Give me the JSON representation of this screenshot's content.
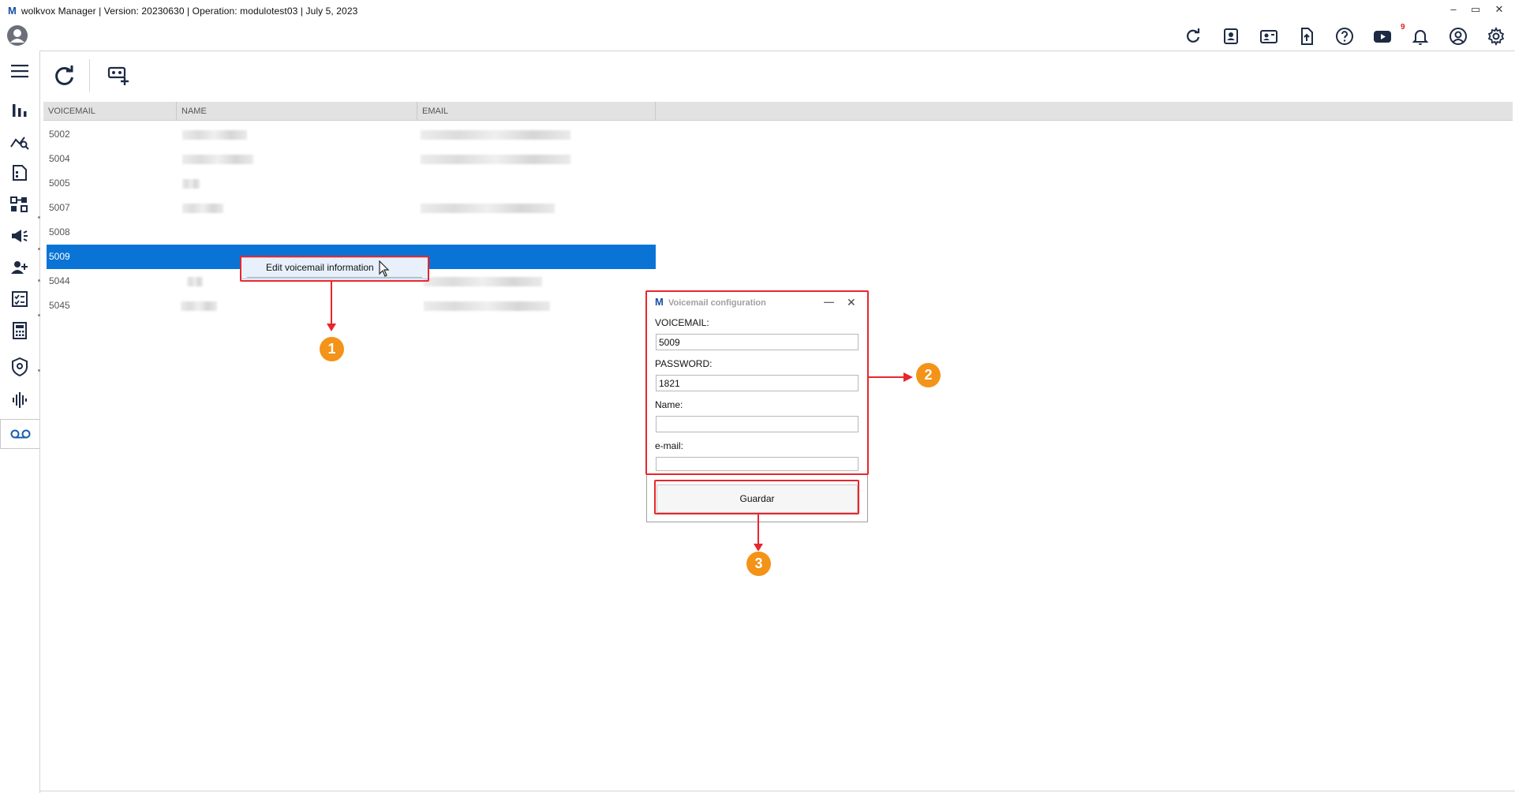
{
  "window": {
    "logo": "M",
    "title": "wolkvox Manager  | Version: 20230630 |  Operation: modulotest03 | July 5, 2023",
    "minimize": "–",
    "restore": "▭",
    "close": "✕"
  },
  "header": {
    "icons": [
      "refresh-icon",
      "contacts-book-icon",
      "id-card-icon",
      "upload-file-icon",
      "help-icon",
      "youtube-icon",
      "bell-icon",
      "user-circle-icon",
      "gear-icon"
    ],
    "notification_count": "9"
  },
  "nav": {
    "items": [
      "menu-icon",
      "bar-chart-icon",
      "analytics-icon",
      "report-icon",
      "flow-icon",
      "campaign-icon",
      "agents-icon",
      "checklist-icon",
      "calculator-icon",
      "security-icon",
      "audio-icon",
      "voicemail-icon"
    ],
    "active": "voicemail-icon"
  },
  "toolbar": {
    "buttons": [
      "refresh-icon",
      "add-voicemail-icon"
    ]
  },
  "grid": {
    "columns": [
      "VOICEMAIL",
      "NAME",
      "EMAIL"
    ],
    "rows": [
      {
        "voicemail": "5002"
      },
      {
        "voicemail": "5004"
      },
      {
        "voicemail": "5005"
      },
      {
        "voicemail": "5007"
      },
      {
        "voicemail": "5008"
      },
      {
        "voicemail": "5009"
      },
      {
        "voicemail": "5044"
      },
      {
        "voicemail": "5045"
      }
    ],
    "selected_row": "5009"
  },
  "context_menu": {
    "item": "Edit voicemail information"
  },
  "dialog": {
    "logo": "M",
    "title": "Voicemail configuration",
    "minimize": "—",
    "close": "✕",
    "voicemail_label": "VOICEMAIL:",
    "voicemail_value": "5009",
    "password_label": "PASSWORD:",
    "password_value": "1821",
    "name_label": "Name:",
    "name_value": "",
    "email_label": "e-mail:",
    "email_value": "",
    "save_label": "Guardar"
  },
  "callouts": [
    "1",
    "2",
    "3"
  ],
  "colors": {
    "selection": "#0a74d6",
    "highlight": "#e8262c",
    "badge": "#f39318",
    "brand": "#1a4fa0"
  }
}
